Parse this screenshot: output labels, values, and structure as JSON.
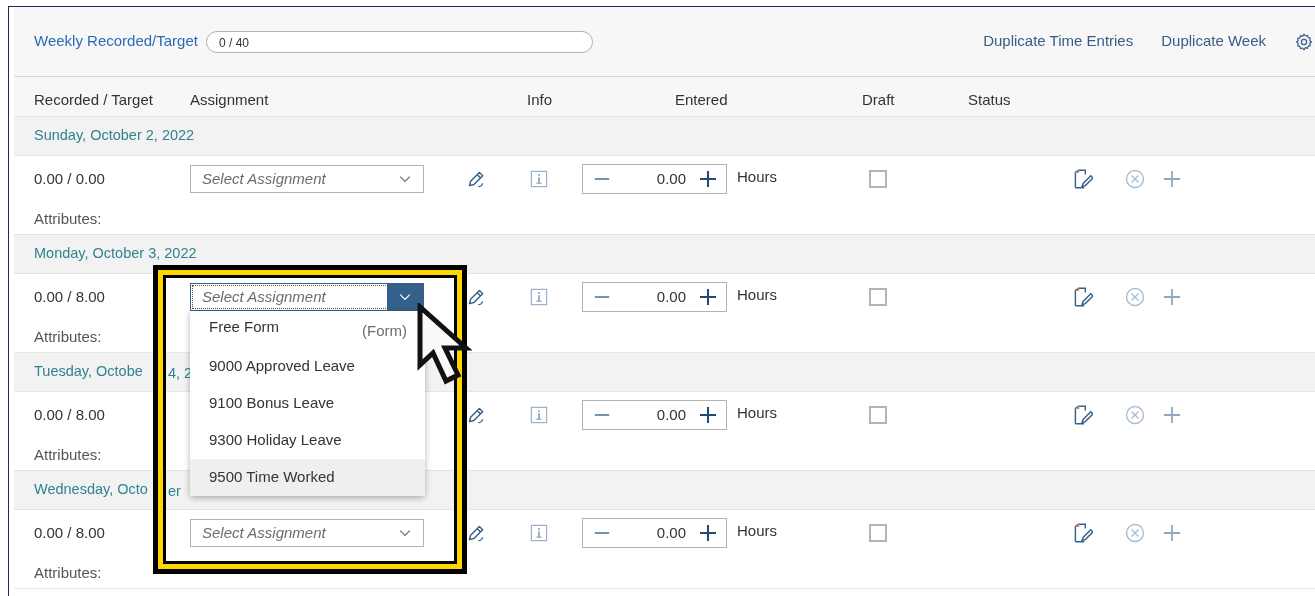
{
  "toolbar": {
    "weekly_link": "Weekly Recorded/Target",
    "weekly_progress": {
      "text": "0 / 40",
      "level": 0
    },
    "actions": [
      "Duplicate Time Entries",
      "Duplicate Week"
    ]
  },
  "columns": [
    "Recorded / Target",
    "Assignment",
    "Info",
    "Entered",
    "Draft",
    "Status"
  ],
  "days": [
    {
      "date": "Sunday, October 2, 2022",
      "recorded": "0.00 / 0.00",
      "assignment": {
        "placeholder": "Select Assignment",
        "expanded": false
      },
      "entered": "0.00",
      "unit": "Hours",
      "draft": false,
      "attributes_label": "Attributes:"
    },
    {
      "date": "Monday, October 3, 2022",
      "recorded": "0.00 / 8.00",
      "assignment": {
        "placeholder": "Select Assignment",
        "expanded": true
      },
      "entered": "0.00",
      "unit": "Hours",
      "draft": false,
      "attributes_label": "Attributes:"
    },
    {
      "date": "Tuesday, Octobe",
      "date_rest": "4, 2",
      "recorded": "0.00 / 8.00",
      "entered": "0.00",
      "unit": "Hours",
      "draft": false,
      "attributes_label": "Attributes:"
    },
    {
      "date": "Wednesday, Octo",
      "date_rest": "er",
      "recorded": "0.00 / 8.00",
      "assignment": {
        "placeholder": "Select Assignment",
        "expanded": false
      },
      "entered": "0.00",
      "unit": "Hours",
      "draft": false,
      "attributes_label": "Attributes:"
    }
  ],
  "assignment_options": [
    {
      "label": "Free Form",
      "note": "(Form)",
      "selected": false
    },
    {
      "label": "9000 Approved Leave",
      "selected": false
    },
    {
      "label": "9100 Bonus Leave",
      "selected": false
    },
    {
      "label": "9300 Holiday Leave",
      "selected": false
    },
    {
      "label": "9500 Time Worked",
      "selected": true
    }
  ]
}
